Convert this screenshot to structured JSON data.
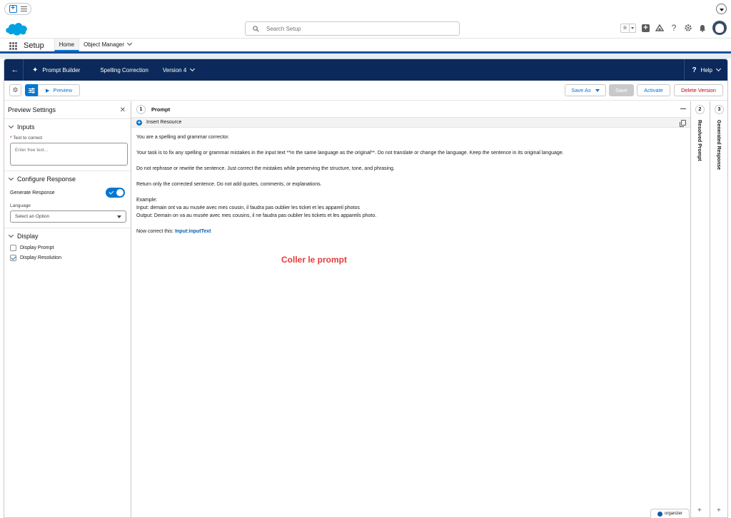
{
  "global": {
    "search_placeholder": "Search Setup",
    "star_glyph": "★",
    "help_glyph": "?"
  },
  "setup_nav": {
    "title": "Setup",
    "tabs": [
      {
        "label": "Home",
        "active": true
      },
      {
        "label": "Object Manager",
        "active": false
      }
    ]
  },
  "builder_header": {
    "app_name": "Prompt Builder",
    "template_name": "Spelling Correction",
    "version": "Version 4",
    "help": "Help"
  },
  "toolbar": {
    "preview": "Preview",
    "save_as": "Save As",
    "save": "Save",
    "activate": "Activate",
    "delete_version": "Delete Version"
  },
  "preview_settings": {
    "title": "Preview Settings",
    "inputs": {
      "title": "Inputs",
      "text_label": "Text to correct",
      "text_placeholder": "Enter free text..."
    },
    "configure": {
      "title": "Configure Response",
      "generate_label": "Generate Response",
      "generate_on": true,
      "language_label": "Language",
      "language_placeholder": "Select an Option"
    },
    "display": {
      "title": "Display",
      "display_prompt": "Display Prompt",
      "display_prompt_checked": false,
      "display_resolution": "Display Resolution",
      "display_resolution_checked": true
    }
  },
  "prompt_panel": {
    "number": "1",
    "title": "Prompt",
    "insert_resource": "Insert Resource",
    "lines": {
      "l1": "You are a spelling and grammar corrector.",
      "l2": "Your task is to fix any spelling or grammar mistakes in the input text **in the same language as the original**. Do not translate or change the language. Keep the sentence in its original language.",
      "l3": "Do not rephrase or rewrite the sentence. Just correct the mistakes while preserving the structure, tone, and phrasing.",
      "l4": "Return only the corrected sentence. Do not add quotes, comments, or explanations.",
      "l5": "Example:",
      "l6": "Input: demain ont va au musée avec mes cousin, il faudra pas oublier les ticket et les appareil photos",
      "l7": "Output: Demain on va au musée avec mes cousins, il ne faudra pas oublier les tickets et les appareils photo.",
      "l8_prefix": "Now correct this:",
      "l8_merge": "Input:inputText"
    }
  },
  "annotation": "Coller le prompt",
  "resolved_panel": {
    "number": "2",
    "title": "Resolved Prompt"
  },
  "generated_panel": {
    "number": "3",
    "title": "Generated Response"
  },
  "organizer": "organizer",
  "colors": {
    "brand_blue": "#0176d3",
    "header_navy": "#0b2a5b",
    "annotation_red": "#e63a3a",
    "delete_red": "#ba0517"
  }
}
